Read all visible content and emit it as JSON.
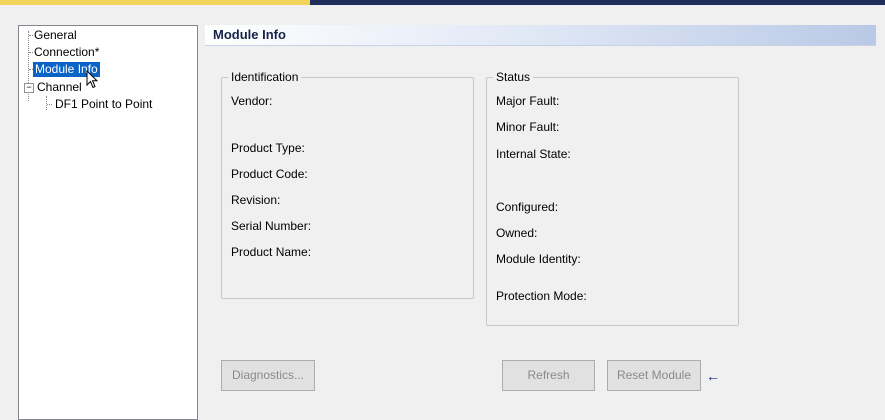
{
  "tree": {
    "items": [
      {
        "label": "General"
      },
      {
        "label": "Connection*"
      },
      {
        "label": "Module Info"
      },
      {
        "label": "Channel"
      },
      {
        "label": "DF1 Point to Point"
      }
    ],
    "expander_symbol": "−"
  },
  "header": {
    "title": "Module Info"
  },
  "identification": {
    "legend": "Identification",
    "fields": [
      "Vendor:",
      "Product Type:",
      "Product Code:",
      "Revision:",
      "Serial Number:",
      "Product Name:"
    ]
  },
  "status": {
    "legend": "Status",
    "fields": [
      "Major Fault:",
      "Minor Fault:",
      "Internal State:",
      "Configured:",
      "Owned:",
      "Module Identity:",
      "Protection Mode:"
    ]
  },
  "buttons": {
    "diagnostics": "Diagnostics...",
    "refresh": "Refresh",
    "reset": "Reset Module"
  },
  "arrow_glyph": "←",
  "colors": {
    "selection": "#0a64c8",
    "disabled_text": "#8a8a8a",
    "header_text": "#14244a"
  }
}
